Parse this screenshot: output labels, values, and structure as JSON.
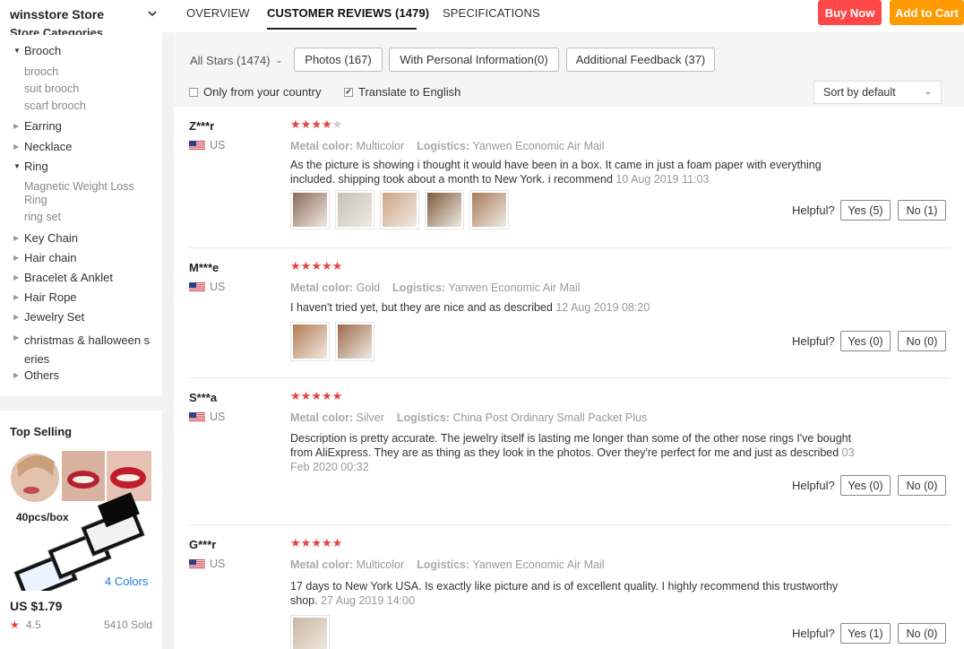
{
  "header": {
    "store_name": "winsstore Store",
    "tabs": [
      "OVERVIEW",
      "CUSTOMER REVIEWS (1479)",
      "SPECIFICATIONS"
    ],
    "buy_now": "Buy Now",
    "add_to_cart": "Add to Cart",
    "buy_now_color": "#ff4747",
    "add_to_cart_color": "#ff9a00"
  },
  "sidebar": {
    "categories_heading": "Store Categories",
    "categories": [
      {
        "label": "Brooch",
        "expanded": true,
        "children": [
          "brooch",
          "suit brooch",
          "scarf brooch"
        ]
      },
      {
        "label": "Earring",
        "expanded": false
      },
      {
        "label": "Necklace",
        "expanded": false
      },
      {
        "label": "Ring",
        "expanded": true,
        "children": [
          "Magnetic Weight Loss Ring",
          "ring set"
        ]
      },
      {
        "label": "Key Chain",
        "expanded": false
      },
      {
        "label": "Hair chain",
        "expanded": false
      },
      {
        "label": "Bracelet & Anklet",
        "expanded": false
      },
      {
        "label": "Hair Rope",
        "expanded": false
      },
      {
        "label": "Jewelry Set",
        "expanded": false
      },
      {
        "label": "christmas & halloween series",
        "expanded": false
      },
      {
        "label": "Others",
        "expanded": false
      }
    ],
    "top_selling": {
      "title": "Top Selling",
      "image_caption_1": "40pcs/box",
      "image_caption_2": "4 Colors",
      "price": "US $1.79",
      "rating": "4.5",
      "sold": "5410 Sold"
    }
  },
  "filters": {
    "all_stars": "All Stars (1474)",
    "photos": "Photos (167)",
    "personal_info": "With Personal Information(0)",
    "additional_feedback": "Additional Feedback (37)",
    "only_country": "Only from your country",
    "translate": "Translate to English",
    "only_country_checked": false,
    "translate_checked": true,
    "sort": "Sort by default"
  },
  "reviews": [
    {
      "user": "Z***r",
      "country": "US",
      "stars": 4,
      "metal_color_label": "Metal color:",
      "metal_color": "Multicolor",
      "logistics_label": "Logistics:",
      "logistics": "Yanwen Economic Air Mail",
      "text": "As the picture is showing i thought it would have been in a box. It came in just a foam paper with everything included. shipping took about a month to New York. i recommend",
      "date": "10 Aug 2019 11:03",
      "photos": 5,
      "helpful_label": "Helpful?",
      "yes": "Yes (5)",
      "no": "No (1)"
    },
    {
      "user": "M***e",
      "country": "US",
      "stars": 5,
      "metal_color_label": "Metal color:",
      "metal_color": "Gold",
      "logistics_label": "Logistics:",
      "logistics": "Yanwen Economic Air Mail",
      "text": "I haven't tried yet, but they are nice and as described",
      "date": "12 Aug 2019 08:20",
      "photos": 2,
      "helpful_label": "Helpful?",
      "yes": "Yes (0)",
      "no": "No (0)"
    },
    {
      "user": "S***a",
      "country": "US",
      "stars": 5,
      "metal_color_label": "Metal color:",
      "metal_color": "Silver",
      "logistics_label": "Logistics:",
      "logistics": "China Post Ordinary Small Packet Plus",
      "text": "Description is pretty accurate. The jewelry itself is lasting me longer than some of the other nose rings I've bought from AliExpress. They are as thing as they look in the photos. Over they're perfect for me and just as described",
      "date": "03 Feb 2020 00:32",
      "photos": 0,
      "helpful_label": "Helpful?",
      "yes": "Yes (0)",
      "no": "No (0)"
    },
    {
      "user": "G***r",
      "country": "US",
      "stars": 5,
      "metal_color_label": "Metal color:",
      "metal_color": "Multicolor",
      "logistics_label": "Logistics:",
      "logistics": "Yanwen Economic Air Mail",
      "text": "17 days to New York USA. Is exactly like picture and is of excellent quality. I highly recommend this trustworthy shop.",
      "date": "27 Aug 2019 14:00",
      "photos": 1,
      "helpful_label": "Helpful?",
      "yes": "Yes (1)",
      "no": "No (0)"
    }
  ]
}
